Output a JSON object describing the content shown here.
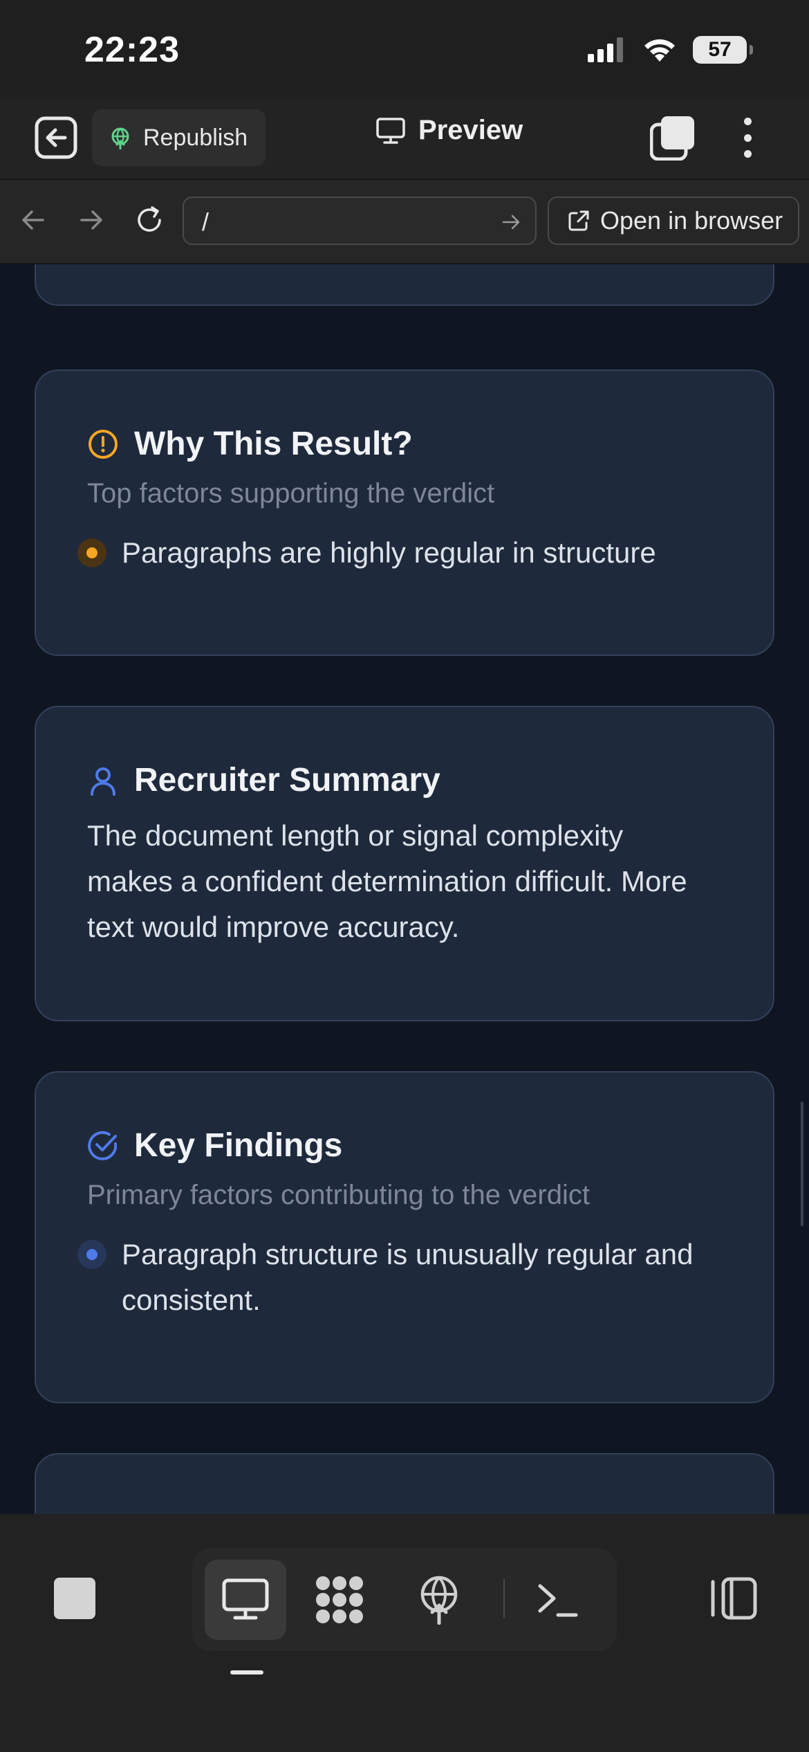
{
  "status_bar": {
    "time": "22:23",
    "battery": "57",
    "icons": [
      "signal-icon",
      "wifi-icon",
      "battery-icon"
    ]
  },
  "toolbar": {
    "republish_label": "Republish",
    "preview_label": "Preview",
    "icons": [
      "exit-icon",
      "globe-icon",
      "monitor-icon",
      "tabs-icon",
      "more-vertical-icon"
    ]
  },
  "browser": {
    "url_value": "/",
    "open_in_browser_label": "Open in browser",
    "icons": [
      "back-arrow-icon",
      "forward-arrow-icon",
      "reload-icon",
      "go-arrow-icon",
      "external-link-icon"
    ]
  },
  "cards": {
    "why": {
      "title": "Why This Result?",
      "subtitle": "Top factors supporting the verdict",
      "items": [
        "Paragraphs are highly regular in structure"
      ],
      "accent": "#f5a623"
    },
    "recruiter": {
      "title": "Recruiter Summary",
      "text": "The document length or signal complexity makes a confident determination difficult. More text would improve accuracy.",
      "accent": "#4f7be8"
    },
    "findings": {
      "title": "Key Findings",
      "subtitle": "Primary factors contributing to the verdict",
      "items": [
        "Paragraph structure is unusually regular and consistent."
      ],
      "accent": "#4f7be8"
    }
  },
  "bottom_bar": {
    "icons": [
      "stop-icon",
      "desktop-preview-icon",
      "apps-grid-icon",
      "deploy-globe-icon",
      "terminal-icon",
      "side-panel-icon"
    ],
    "active": "desktop-preview-icon"
  },
  "colors": {
    "content_bg": "#0f1622",
    "card_bg": "#1e293b",
    "card_border": "#33415a",
    "warning": "#f5a623",
    "info": "#4f7be8"
  }
}
